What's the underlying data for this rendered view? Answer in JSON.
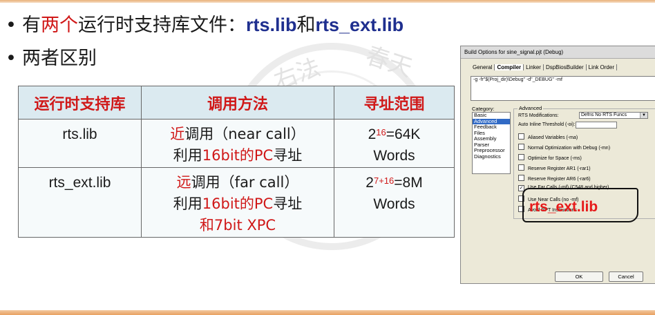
{
  "bullet1": {
    "prefix": "有",
    "red": "两个",
    "middle": "运行时支持库文件：",
    "lib1": "rts.lib",
    "and": "和",
    "lib2": "rts_ext.lib"
  },
  "bullet2": {
    "text": "两者区别"
  },
  "watermark": {
    "text1": "右法",
    "text2": "春天"
  },
  "table": {
    "headers": [
      "运行时支持库",
      "调用方法",
      "寻址范围"
    ],
    "rows": [
      {
        "lib": "rts.lib",
        "call_keyword": "近",
        "call_rest": "调用（near call）",
        "method_pre": "利用",
        "method_red": "16bit的PC",
        "method_post": "寻址",
        "method_red2": "",
        "range_base": "2",
        "range_exp": "16",
        "range_val": "=64K",
        "range_unit": "Words"
      },
      {
        "lib": "rts_ext.lib",
        "call_keyword": "远",
        "call_rest": "调用（far call）",
        "method_pre": "利用",
        "method_red": "16bit的PC",
        "method_post": "寻址",
        "method_red2": "和7bit XPC",
        "range_base": "2",
        "range_exp": "7+16",
        "range_val": "=8M",
        "range_unit": "Words"
      }
    ]
  },
  "dialog": {
    "title": "Build Options for sine_signal.pjt (Debug)",
    "tabs": [
      "General",
      "Compiler",
      "Linker",
      "DspBiosBuilder",
      "Link Order"
    ],
    "active_tab": "Compiler",
    "command": "-g -fr\"$(Proj_dir)\\Debug\" -d\"_DEBUG\" -mf",
    "category_label": "Category:",
    "categories": [
      "Basic",
      "Advanced",
      "Feedback",
      "Files",
      "Assembly",
      "Parser",
      "Preprocessor",
      "Diagnostics"
    ],
    "selected_category": "Advanced",
    "group_title": "Advanced",
    "rts_label": "RTS Modifications:",
    "rts_value": "Defns No RTS Funcs",
    "auto_inline_label": "Auto Inline Threshold (-oi):",
    "options": [
      {
        "label": "Aliased Variables (-ma)",
        "checked": false
      },
      {
        "label": "Normal Optimization with Debug (-mn)",
        "checked": false
      },
      {
        "label": "Optimize for Space (-ms)",
        "checked": false
      },
      {
        "label": "Reserve Register AR1 (-rar1)",
        "checked": false
      },
      {
        "label": "Reserve Register AR6 (-rar6)",
        "checked": false
      },
      {
        "label": "Use Far Calls (-mf) (C548 and higher)",
        "checked": true
      },
      {
        "label": "Use Near Calls (no -mf)",
        "checked": false
      },
      {
        "label": "Avoid RPT Instructions",
        "checked": false
      }
    ],
    "ok_label": "OK",
    "cancel_label": "Cancel"
  },
  "callout": {
    "text": "rts_ext.lib"
  }
}
